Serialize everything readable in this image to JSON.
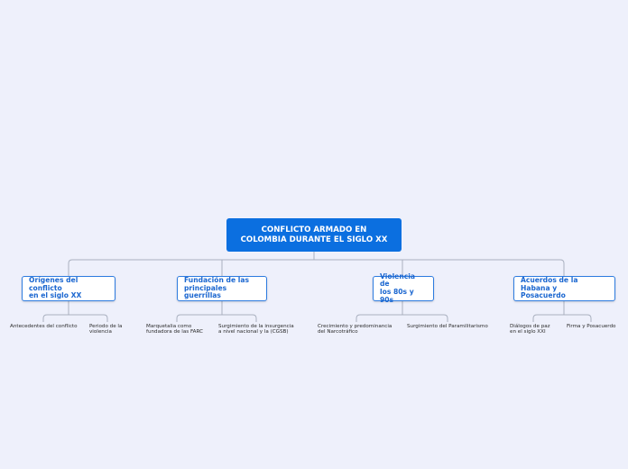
{
  "root": {
    "line1": "CONFLICTO ARMADO EN",
    "line2": "COLOMBIA DURANTE EL SIGLO XX"
  },
  "topics": [
    {
      "line1": "Orígenes del conflicto",
      "line2": "en el siglo XX",
      "subs": [
        {
          "line1": "Antecedentes del conflicto",
          "line2": ""
        },
        {
          "line1": "Periodo de la",
          "line2": "violencia"
        }
      ]
    },
    {
      "line1": "Fundación de las",
      "line2": "principales guerrillas",
      "subs": [
        {
          "line1": "Marquetalia como",
          "line2": "fundadora de las FARC"
        },
        {
          "line1": "Surgimiento de la insurgencia",
          "line2": "a nivel nacional y la (CGSB)"
        }
      ]
    },
    {
      "line1": "Violencia de",
      "line2": "los 80s y 90s",
      "subs": [
        {
          "line1": "Crecimiento y predominancia",
          "line2": "del Narcotráfico"
        },
        {
          "line1": "Surgimiento del Paramilitarismo",
          "line2": ""
        }
      ]
    },
    {
      "line1": "Acuerdos de la Habana y",
      "line2": "Posacuerdo",
      "subs": [
        {
          "line1": "Diálogos de paz",
          "line2": "en el siglo XXI"
        },
        {
          "line1": "Firma y Posacuerdo",
          "line2": ""
        }
      ]
    }
  ],
  "colors": {
    "background": "#eef0fb",
    "root": "#0b6fe0",
    "topic_border": "#2e7ce0",
    "topic_text": "#1a66d0",
    "connector": "#a9b0bf"
  }
}
